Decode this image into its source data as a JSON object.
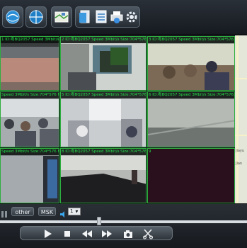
{
  "toolbar": {
    "buttons": [
      {
        "icon": "refresh-globe-icon"
      },
      {
        "icon": "crosshair-globe-icon"
      },
      {
        "icon": "map-view-icon"
      },
      {
        "icon": "document-icon"
      },
      {
        "icon": "list-icon"
      },
      {
        "icon": "printer-icon"
      },
      {
        "icon": "settings-icon"
      }
    ]
  },
  "channels": [
    {
      "id": "1",
      "caption": "1  ID:粤BQ2057  Speed  3Mbit/s  Size:704*576  Frame"
    },
    {
      "id": "2",
      "caption": "2  ID:粤BQ2057  Speed  3Mbit/s  Size:704*576  Frame"
    },
    {
      "id": "3",
      "caption": "3  ID:粤BQ2057  Speed  3Mbit/s  Size:704*576  Frame"
    },
    {
      "id": "4",
      "caption": "Speed  3Mbit/s  Size:704*576  Frame"
    },
    {
      "id": "5",
      "caption": "5  ID:粤BQ2057  Speed  3Mbit/s  Size:704*576  Frame"
    },
    {
      "id": "6",
      "caption": "6  ID:粤BQ2057  Speed  3Mbit/s  Size:704*576  Frame"
    },
    {
      "id": "7",
      "caption": "Speed  3Mbit/s  Size:704*576  Frame"
    },
    {
      "id": "8",
      "caption": "8  ID:粤BQ2057  Speed  3Mbit/s  Size:704*576  Frame"
    },
    {
      "id": "9",
      "caption": "9"
    }
  ],
  "map": {
    "labels": [
      "Jiayu",
      "Jian"
    ]
  },
  "bottom": {
    "other_label": "other",
    "msk_label": "MSK",
    "volume_value": "1"
  },
  "playback": {
    "progress": 0.4,
    "controls": [
      "play",
      "stop",
      "rewind",
      "fast-forward",
      "snapshot",
      "cut"
    ]
  },
  "colors": {
    "caption_text": "#22e04a",
    "cell_border": "#2fae3f"
  }
}
